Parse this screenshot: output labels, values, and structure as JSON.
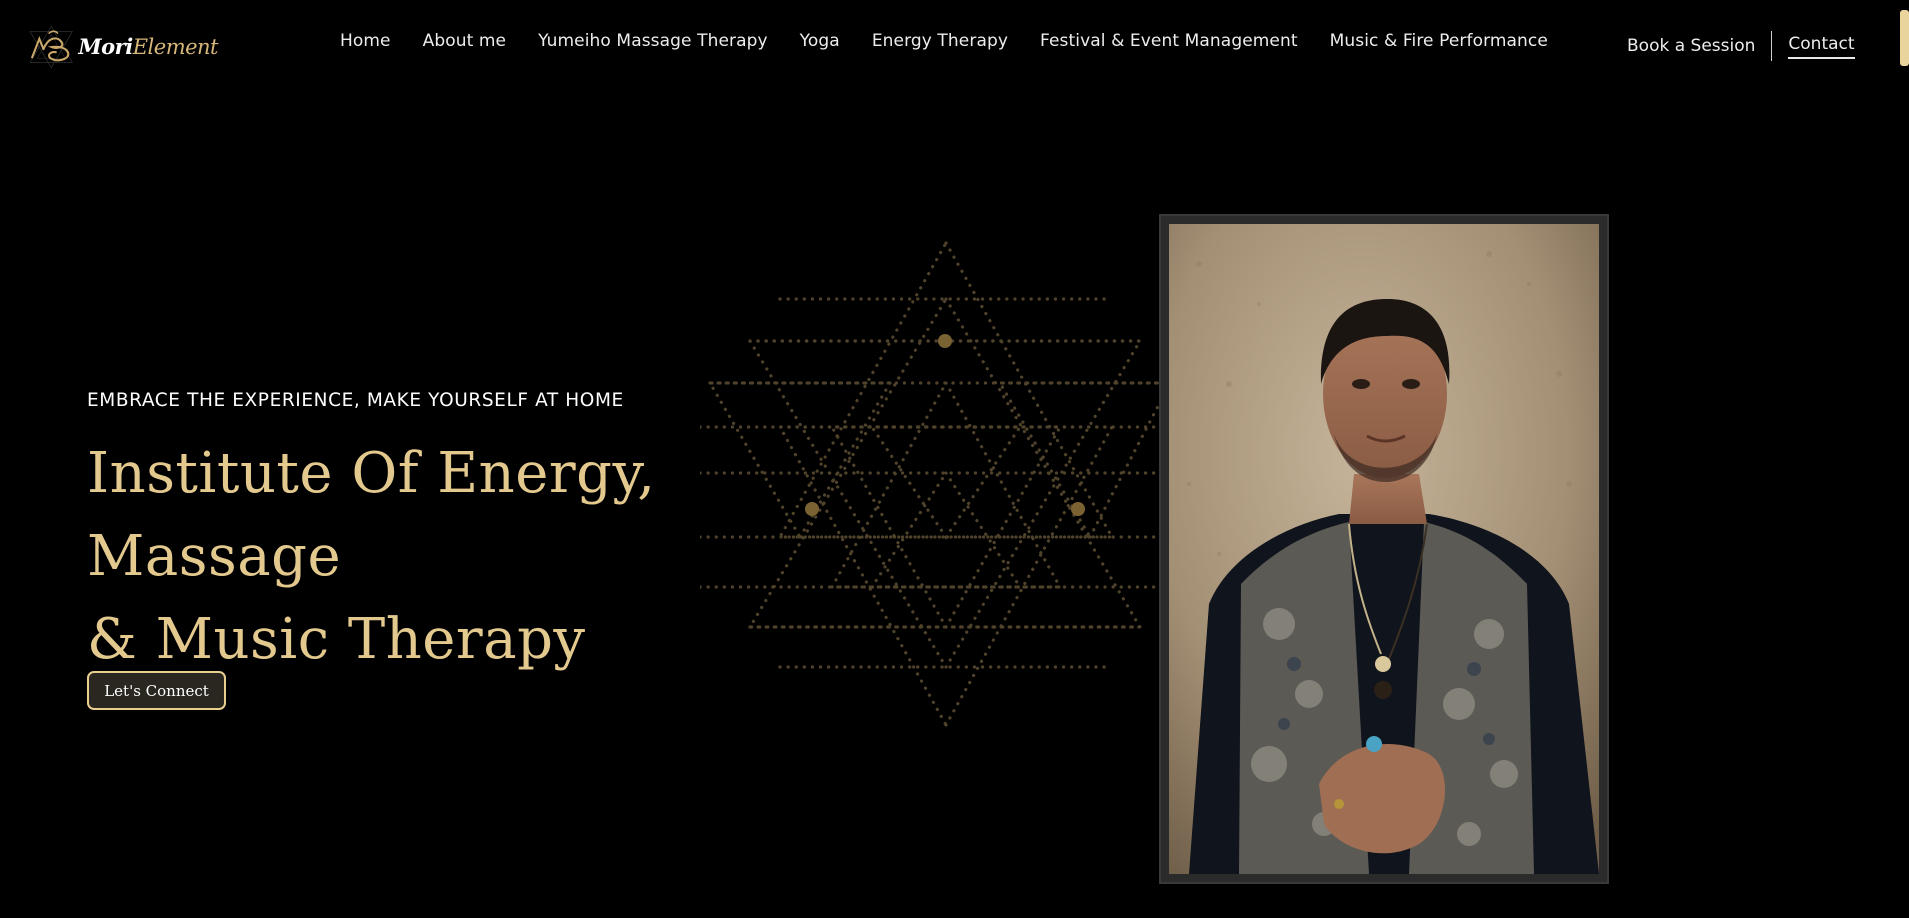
{
  "brand": {
    "logo_icon": "moriel-logo-mark",
    "name_primary": "Mori",
    "name_secondary": "Element",
    "colors": {
      "gold": "#e3c98e",
      "background": "#000000",
      "accent_bar": "#e9d59b"
    }
  },
  "nav": {
    "items": [
      {
        "label": "Home"
      },
      {
        "label": "About me"
      },
      {
        "label": "Yumeiho Massage Therapy"
      },
      {
        "label": "Yoga"
      },
      {
        "label": "Energy Therapy"
      },
      {
        "label": "Festival & Event Management"
      },
      {
        "label": "Music & Fire Performance"
      }
    ],
    "book_label": "Book a Session",
    "contact_label": "Contact"
  },
  "hero": {
    "eyebrow": "EMBRACE THE EXPERIENCE, MAKE YOURSELF AT HOME",
    "title_line1": "Institute Of Energy, Massage",
    "title_line2": "& Music Therapy",
    "cta_label": "Let's Connect",
    "decoration_icon": "sri-yantra-dotted-icon"
  }
}
